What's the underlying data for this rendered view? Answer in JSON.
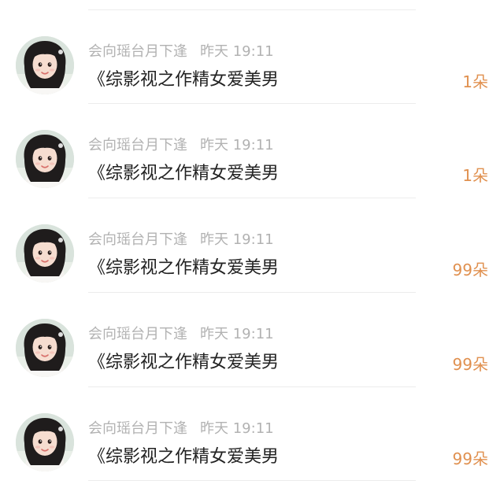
{
  "list": {
    "items": [
      {
        "author": "会向瑶台月下逢",
        "time": "昨天 19:11",
        "title": "《综影视之作精女爱美男",
        "flowers": "1朵"
      },
      {
        "author": "会向瑶台月下逢",
        "time": "昨天 19:11",
        "title": "《综影视之作精女爱美男",
        "flowers": "1朵"
      },
      {
        "author": "会向瑶台月下逢",
        "time": "昨天 19:11",
        "title": "《综影视之作精女爱美男",
        "flowers": "99朵"
      },
      {
        "author": "会向瑶台月下逢",
        "time": "昨天 19:11",
        "title": "《综影视之作精女爱美男",
        "flowers": "99朵"
      },
      {
        "author": "会向瑶台月下逢",
        "time": "昨天 19:11",
        "title": "《综影视之作精女爱美男",
        "flowers": "99朵"
      }
    ]
  },
  "colors": {
    "accent": "#e0904f",
    "meta_text": "#b2b2b2",
    "title_text": "#222222",
    "divider": "#ececec"
  },
  "icons": {
    "avatar": "user-avatar-photo"
  }
}
